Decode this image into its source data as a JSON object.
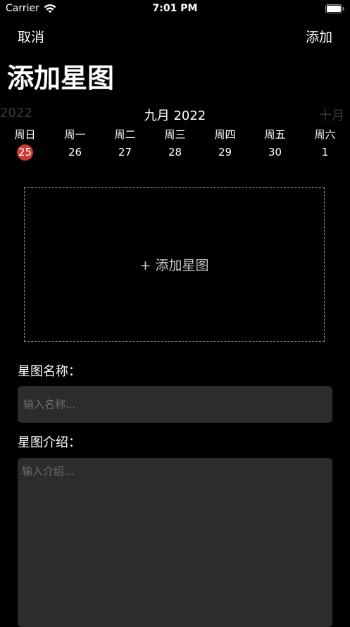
{
  "status_bar": {
    "carrier": "Carrier",
    "time": "7:01 PM",
    "icons": [
      "wifi-icon",
      "battery-icon"
    ]
  },
  "nav": {
    "cancel_label": "取消",
    "add_label": "添加",
    "title": "添加星图"
  },
  "calendar": {
    "prev_label": "2022",
    "current_label": "九月 2022",
    "next_label": "十月",
    "weekdays": [
      "周日",
      "周一",
      "周二",
      "周三",
      "周四",
      "周五",
      "周六"
    ],
    "days": [
      "25",
      "26",
      "27",
      "28",
      "29",
      "30",
      "1"
    ],
    "selected_day": "25",
    "selected_color": "#cc3a34"
  },
  "upload": {
    "label": "+ 添加星图"
  },
  "form": {
    "name_label": "星图名称：",
    "name_placeholder": "输入名称...",
    "name_value": "",
    "desc_label": "星图介绍：",
    "desc_placeholder": "输入介绍...",
    "desc_value": ""
  }
}
